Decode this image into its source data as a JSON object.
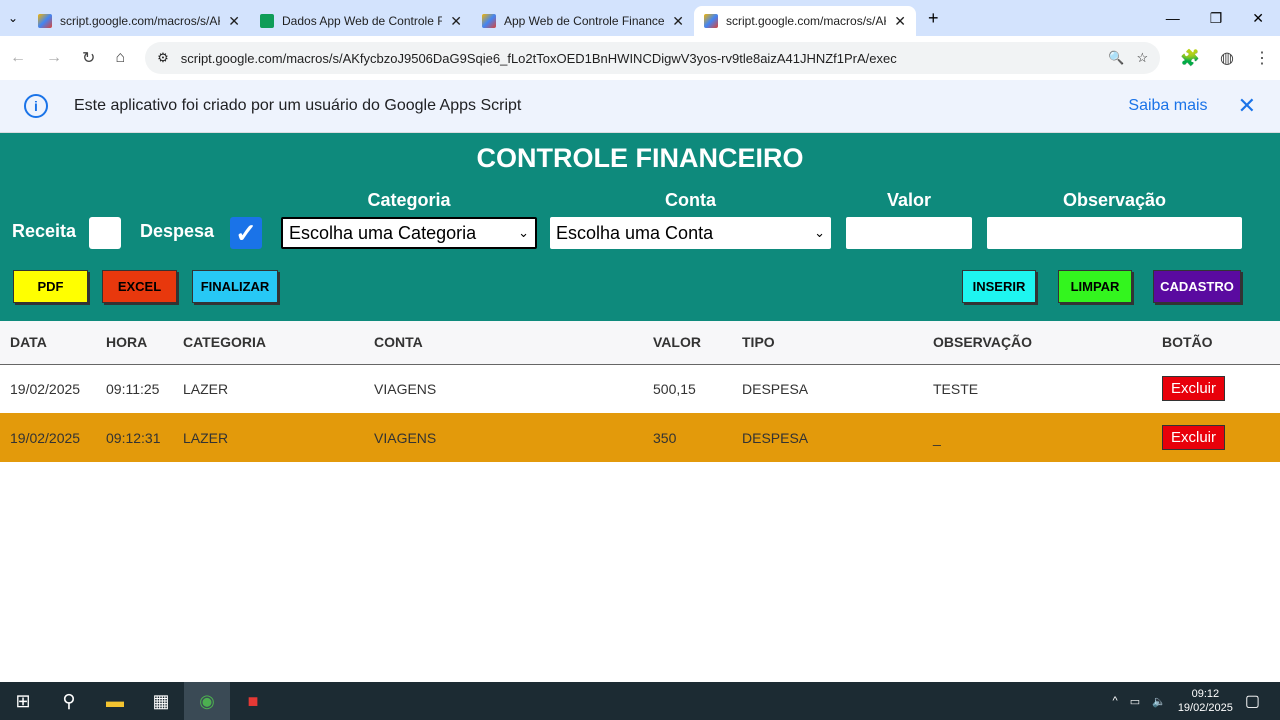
{
  "browser": {
    "tabs": [
      {
        "title": "script.google.com/macros/s/AK"
      },
      {
        "title": "Dados App Web de Controle Fi"
      },
      {
        "title": "App Web de Controle Financeir"
      },
      {
        "title": "script.google.com/macros/s/AK"
      }
    ],
    "url": "script.google.com/macros/s/AKfycbzoJ9506DaG9Sqie6_fLo2tToxOED1BnHWINCDigwV3yos-rv9tle8aizA41JHNZf1PrA/exec"
  },
  "banner": {
    "text": "Este aplicativo foi criado por um usuário do Google Apps Script",
    "link": "Saiba mais"
  },
  "app": {
    "title": "CONTROLE FINANCEIRO",
    "receita": "Receita",
    "despesa": "Despesa",
    "receita_checked": false,
    "despesa_checked": true,
    "categoria_label": "Categoria",
    "categoria_value": "Escolha uma Categoria",
    "conta_label": "Conta",
    "conta_value": "Escolha uma Conta",
    "valor_label": "Valor",
    "obs_label": "Observação",
    "buttons": {
      "pdf": "PDF",
      "excel": "EXCEL",
      "finalizar": "FINALIZAR",
      "inserir": "INSERIR",
      "limpar": "LIMPAR",
      "cadastro": "CADASTRO"
    }
  },
  "table": {
    "headers": [
      "DATA",
      "HORA",
      "CATEGORIA",
      "CONTA",
      "VALOR",
      "TIPO",
      "OBSERVAÇÃO",
      "BOTÃO"
    ],
    "rows": [
      [
        "19/02/2025",
        "09:11:25",
        "LAZER",
        "VIAGENS",
        "500,15",
        "DESPESA",
        "TESTE",
        "Excluir"
      ],
      [
        "19/02/2025",
        "09:12:31",
        "LAZER",
        "VIAGENS",
        "350",
        "DESPESA",
        "_",
        "Excluir"
      ]
    ]
  },
  "taskbar": {
    "time": "09:12",
    "date": "19/02/2025"
  }
}
